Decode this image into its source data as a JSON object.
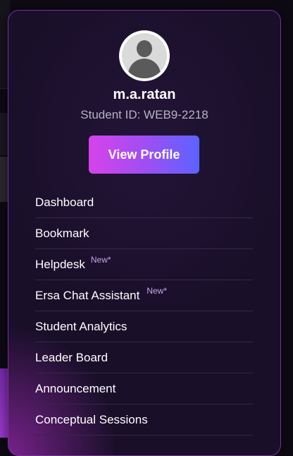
{
  "profile": {
    "username": "m.a.ratan",
    "student_id": "Student ID: WEB9-2218",
    "view_profile_label": "View Profile"
  },
  "menu": {
    "items": [
      {
        "label": "Dashboard",
        "badge": ""
      },
      {
        "label": "Bookmark",
        "badge": ""
      },
      {
        "label": "Helpdesk",
        "badge": "New*"
      },
      {
        "label": "Ersa Chat Assistant",
        "badge": "New*"
      },
      {
        "label": "Student Analytics",
        "badge": ""
      },
      {
        "label": "Leader Board",
        "badge": ""
      },
      {
        "label": "Announcement",
        "badge": ""
      },
      {
        "label": "Conceptual Sessions",
        "badge": ""
      }
    ]
  },
  "colors": {
    "background": "#0d0a14",
    "popup": "#190f29",
    "accent_gradient_start": "#d742ea",
    "accent_gradient_end": "#5b63ff",
    "badge": "#c9a4ee"
  },
  "icons": {
    "avatar": "user-avatar-icon"
  }
}
